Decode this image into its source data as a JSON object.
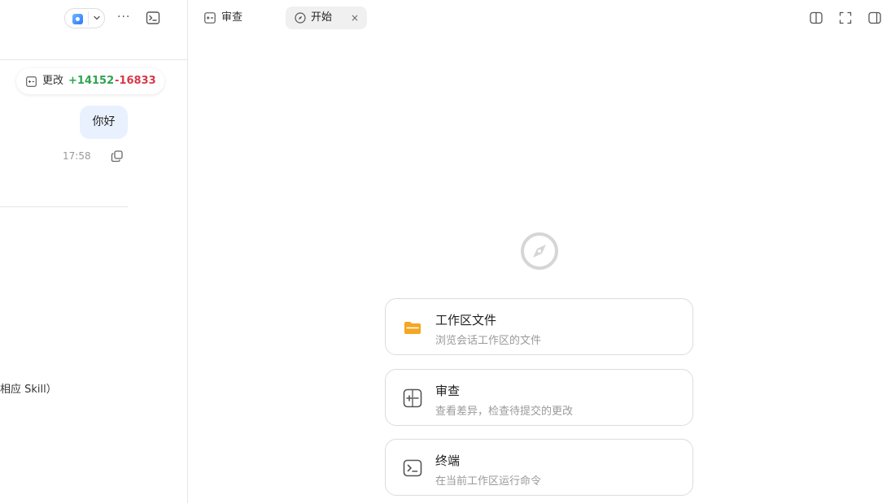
{
  "sidebar": {
    "more_label": "···",
    "changes": {
      "label": "更改",
      "added": "+14152",
      "removed": "-16833"
    },
    "message": {
      "text": "你好",
      "time": "17:58"
    },
    "truncated_text": "相应 Skill）"
  },
  "tabs": [
    {
      "label": "审查",
      "icon": "diff-icon",
      "active": false
    },
    {
      "label": "开始",
      "icon": "compass-icon",
      "active": true,
      "close_label": "×"
    }
  ],
  "toolbar_right": [
    "split-view-icon",
    "fullscreen-icon",
    "right-panel-icon"
  ],
  "main": {
    "cards": [
      {
        "title": "工作区文件",
        "description": "浏览会话工作区的文件",
        "icon": "folder-icon"
      },
      {
        "title": "审查",
        "description": "查看差异，检查待提交的更改",
        "icon": "diff-icon"
      },
      {
        "title": "终端",
        "description": "在当前工作区运行命令",
        "icon": "terminal-icon"
      }
    ]
  },
  "colors": {
    "added": "#2ea44f",
    "removed": "#d73a49",
    "folder": "#f5a623",
    "bubble": "#e9f1ff"
  }
}
